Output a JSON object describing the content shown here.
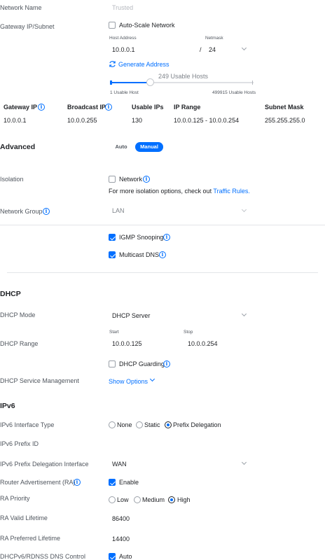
{
  "network": {
    "name_label": "Network Name",
    "name_placeholder": "Trusted",
    "gateway_label": "Gateway IP/Subnet",
    "auto_scale_label": "Auto-Scale Network",
    "host_address_label": "Host Address",
    "host_address_value": "10.0.0.1",
    "netmask_label": "Netmask",
    "slash": "/",
    "netmask_value": "24",
    "generate_label": "Generate Address",
    "usable_hosts_text": "249 Usable Hosts",
    "slider_min_label": "1 Usable Host",
    "slider_max_label": "499915 Usable Hosts",
    "slider_fraction": 0.28
  },
  "table": {
    "headers": [
      "Gateway IP",
      "Broadcast IP",
      "Usable IPs",
      "IP Range",
      "Subnet Mask"
    ],
    "row": [
      "10.0.0.1",
      "10.0.0.255",
      "130",
      "10.0.0.125 - 10.0.0.254",
      "255.255.255.0"
    ]
  },
  "advanced": {
    "title": "Advanced",
    "auto_label": "Auto",
    "manual_label": "Manual",
    "selected": "Manual",
    "isolation_label": "Isolation",
    "isolation_network_label": "Network",
    "isolation_note": "For more isolation options, check out",
    "traffic_rules_link": "Traffic Rules.",
    "network_group_label": "Network Group",
    "network_group_value": "LAN",
    "igmp_label": "IGMP Snooping",
    "multicast_dns_label": "Multicast DNS"
  },
  "dhcp": {
    "title": "DHCP",
    "mode_label": "DHCP Mode",
    "mode_value": "DHCP Server",
    "range_label": "DHCP Range",
    "start_label": "Start",
    "start_value": "10.0.0.125",
    "stop_label": "Stop",
    "stop_value": "10.0.0.254",
    "guarding_label": "DHCP Guarding",
    "service_label": "DHCP Service Management",
    "show_options_label": "Show Options"
  },
  "ipv6": {
    "title": "IPv6",
    "interface_type_label": "IPv6 Interface Type",
    "opt_none": "None",
    "opt_static": "Static",
    "opt_prefix": "Prefix Delegation",
    "prefix_id_label": "IPv6 Prefix ID",
    "pd_interface_label": "IPv6 Prefix Delegation Interface",
    "pd_interface_value": "WAN",
    "ra_label": "Router Advertisement (RA)",
    "ra_enable_label": "Enable",
    "ra_priority_label": "RA Priority",
    "prio_low": "Low",
    "prio_medium": "Medium",
    "prio_high": "High",
    "ra_valid_label": "RA Valid Lifetime",
    "ra_valid_value": "86400",
    "ra_preferred_label": "RA Preferred Lifetime",
    "ra_preferred_value": "14400",
    "dns_control_label": "DHCPv6/RDNSS DNS Control",
    "dns_control_value": "Auto"
  },
  "colors": {
    "accent": "#006fff",
    "text": "#212327",
    "label": "#50565e",
    "divider": "#e3e5e8"
  }
}
